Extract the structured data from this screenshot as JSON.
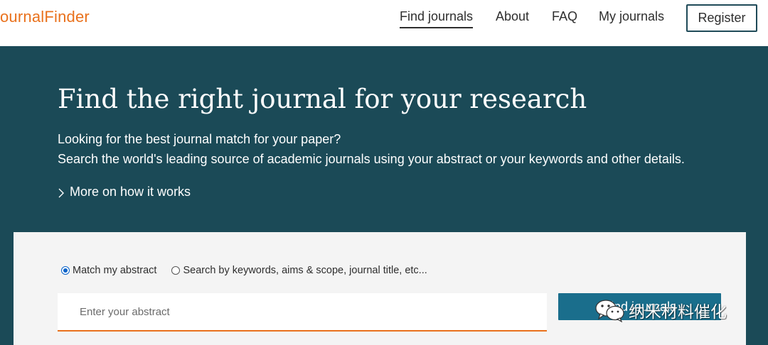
{
  "header": {
    "logo": "ournalFinder",
    "nav": {
      "find_journals": "Find journals",
      "about": "About",
      "faq": "FAQ",
      "my_journals": "My journals"
    },
    "register_label": "Register"
  },
  "hero": {
    "title": "Find the right journal for your research",
    "subtitle_line1": "Looking for the best journal match for your paper?",
    "subtitle_line2": "Search the world's leading source of academic journals using your abstract or your keywords and other details.",
    "more_link": "More on how it works",
    "more_icon": "chevron-right-icon"
  },
  "search": {
    "option_abstract": "Match my abstract",
    "option_keywords": "Search by keywords, aims & scope, journal title, etc...",
    "selected_option": "Match my abstract",
    "abstract_placeholder": "Enter your abstract",
    "abstract_value": "",
    "find_button": "Find journals"
  },
  "watermark": {
    "text": "纳米材料催化",
    "icon": "wechat-icon"
  },
  "colors": {
    "brand_orange": "#e9711c",
    "hero_bg": "#1b4a57",
    "button_teal": "#1a6e8c",
    "register_border": "#1f4a58",
    "card_bg": "#f4f4f4"
  }
}
